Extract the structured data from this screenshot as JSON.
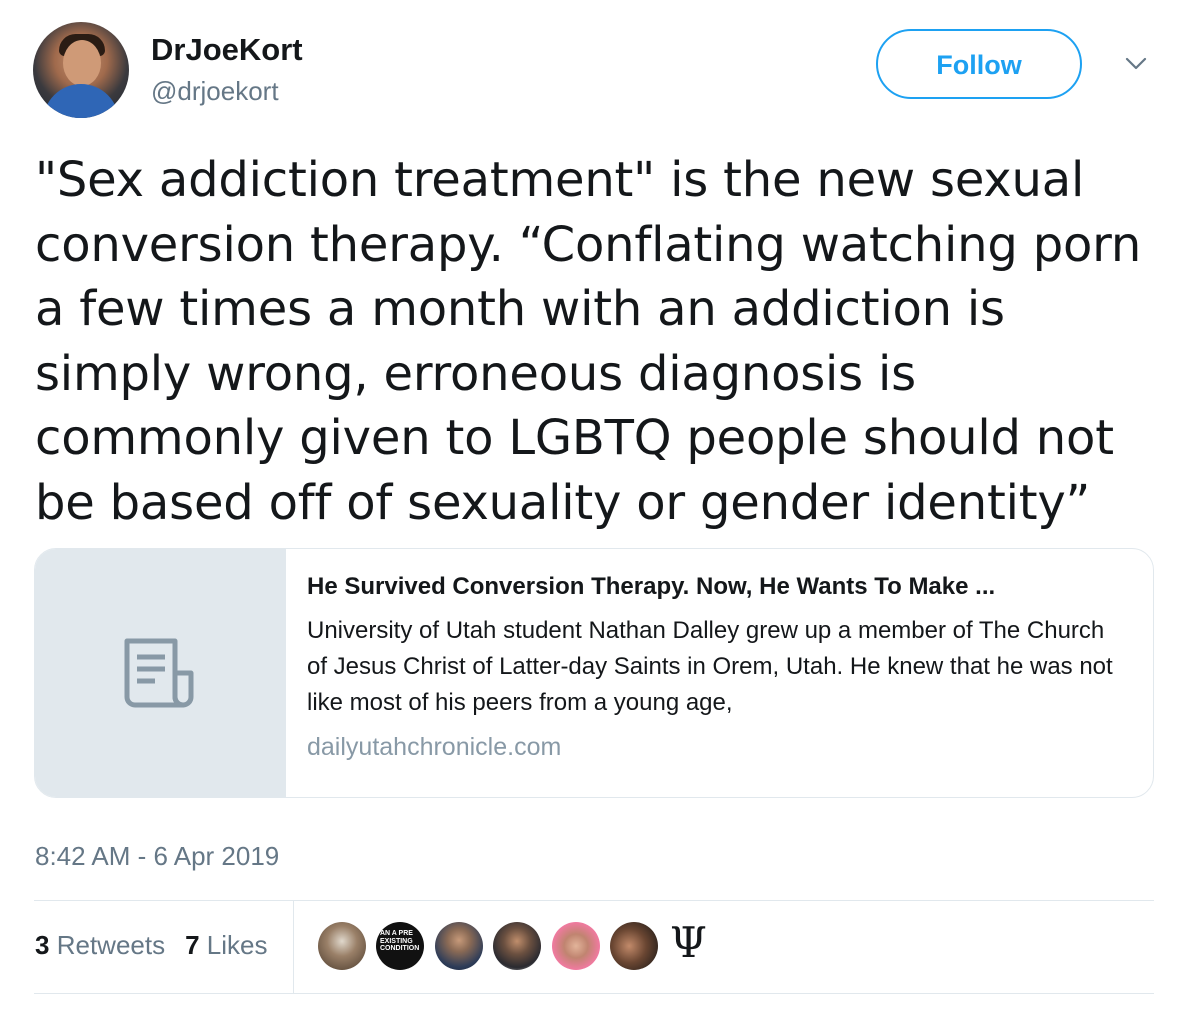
{
  "author": {
    "display_name": "DrJoeKort",
    "handle": "@drjoekort",
    "avatar_icon": "profile-photo"
  },
  "follow_button": {
    "label": "Follow",
    "color": "#1da1f2"
  },
  "tweet": {
    "text": "\"Sex addiction treatment\" is the new sexual conversion therapy. “Conflating watching porn a few times a month with an addiction is simply wrong, erroneous diagnosis is commonly given to LGBTQ people should not be based off of sexuality or gender identity”"
  },
  "link_card": {
    "icon": "document-icon",
    "title": "He Survived Conversion Therapy. Now, He Wants To Make ...",
    "description": "University of Utah student Nathan Dalley grew up a member of The Church of Jesus Christ of Latter-day Saints in Orem, Utah. He knew that he was not like most of his peers from a young age,",
    "domain": "dailyutahchronicle.com"
  },
  "timestamp": "8:42 AM - 6 Apr 2019",
  "stats": {
    "retweets_count": "3",
    "retweets_label": "Retweets",
    "likes_count": "7",
    "likes_label": "Likes"
  },
  "likers": {
    "badge_text": "AN A PRE EXISTING CONDITION",
    "symbol": "Ψ"
  }
}
